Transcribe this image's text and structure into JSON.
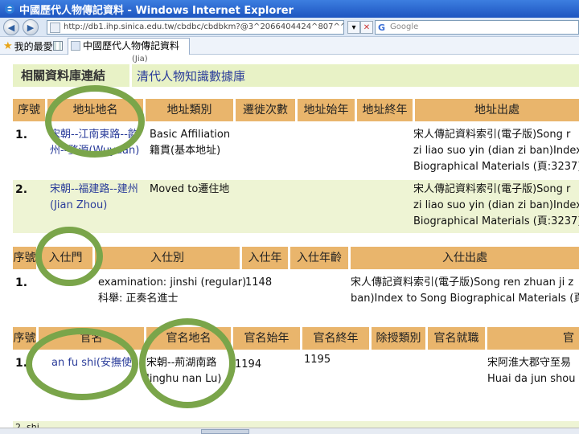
{
  "window": {
    "title": "中國歷代人物傳記資料 - Windows Internet Explorer"
  },
  "toolbar": {
    "address": "http://db1.ihp.sinica.edu.tw/cbdbc/cbdbkm?@3^2066404424^807^^^1",
    "search_placeholder": "Google"
  },
  "favorites": {
    "label": "我的最愛"
  },
  "tab": {
    "label": "中國歷代人物傳記資料"
  },
  "site": {
    "cut_text": "(Jia)",
    "related_label": "相關資料庫連結",
    "related_link": "清代人物知識數據庫"
  },
  "address_table": {
    "headers": [
      "序號",
      "地址地名",
      "地址類別",
      "遷徙次數",
      "地址始年",
      "地址終年",
      "地址出處"
    ],
    "rows": [
      {
        "num": "1.",
        "place_line1": "宋朝--江南東路--歙",
        "place_line2": "州--婺源(Wuyuan)",
        "type_line1": "Basic Affiliation",
        "type_line2": "籍貫(基本地址)",
        "src_line1": "宋人傳記資料索引(電子版)Song r",
        "src_line2": "zi liao suo yin (dian zi ban)Index t",
        "src_line3": "Biographical Materials (頁:3237)"
      },
      {
        "num": "2.",
        "place_line1": "宋朝--福建路--建州",
        "place_line2": "(Jian Zhou)",
        "type_line1": "Moved to遷住地",
        "src_line1": "宋人傳記資料索引(電子版)Song r",
        "src_line2": "zi liao suo yin (dian zi ban)Index t",
        "src_line3": "Biographical Materials (頁:3237)"
      }
    ]
  },
  "entry_table": {
    "headers": [
      "序號",
      "入仕門",
      "入仕別",
      "入仕年",
      "入仕年齡",
      "入仕出處"
    ],
    "rows": [
      {
        "num": "1.",
        "kind_line1": "examination: jinshi (regular)",
        "kind_line2": "科舉: 正奏名進士",
        "year": "1148",
        "src_line1": "宋人傳記資料索引(電子版)Song ren zhuan ji z",
        "src_line2": "ban)Index to Song Biographical Materials (頁:"
      }
    ]
  },
  "office_table": {
    "headers": [
      "序號",
      "官名",
      "官名地名",
      "官名始年",
      "官名終年",
      "除授類別",
      "官名就職",
      "官"
    ],
    "rows": [
      {
        "num": "1.",
        "office": "an fu shi(安撫使)",
        "place_line1": "宋朝--荊湖南路",
        "place_line2": "Jinghu nan Lu)",
        "start": "1194",
        "end": "1195",
        "src_line1": "宋阿淮大郡守至易",
        "src_line2": "Huai da jun shou c"
      }
    ],
    "next_row_fragment": "2.        shi"
  },
  "colors": {
    "header_bg": "#e9b56c",
    "alt_row_bg": "#eef4d4",
    "link": "#2a3c9a",
    "circle": "#7aa54a"
  }
}
